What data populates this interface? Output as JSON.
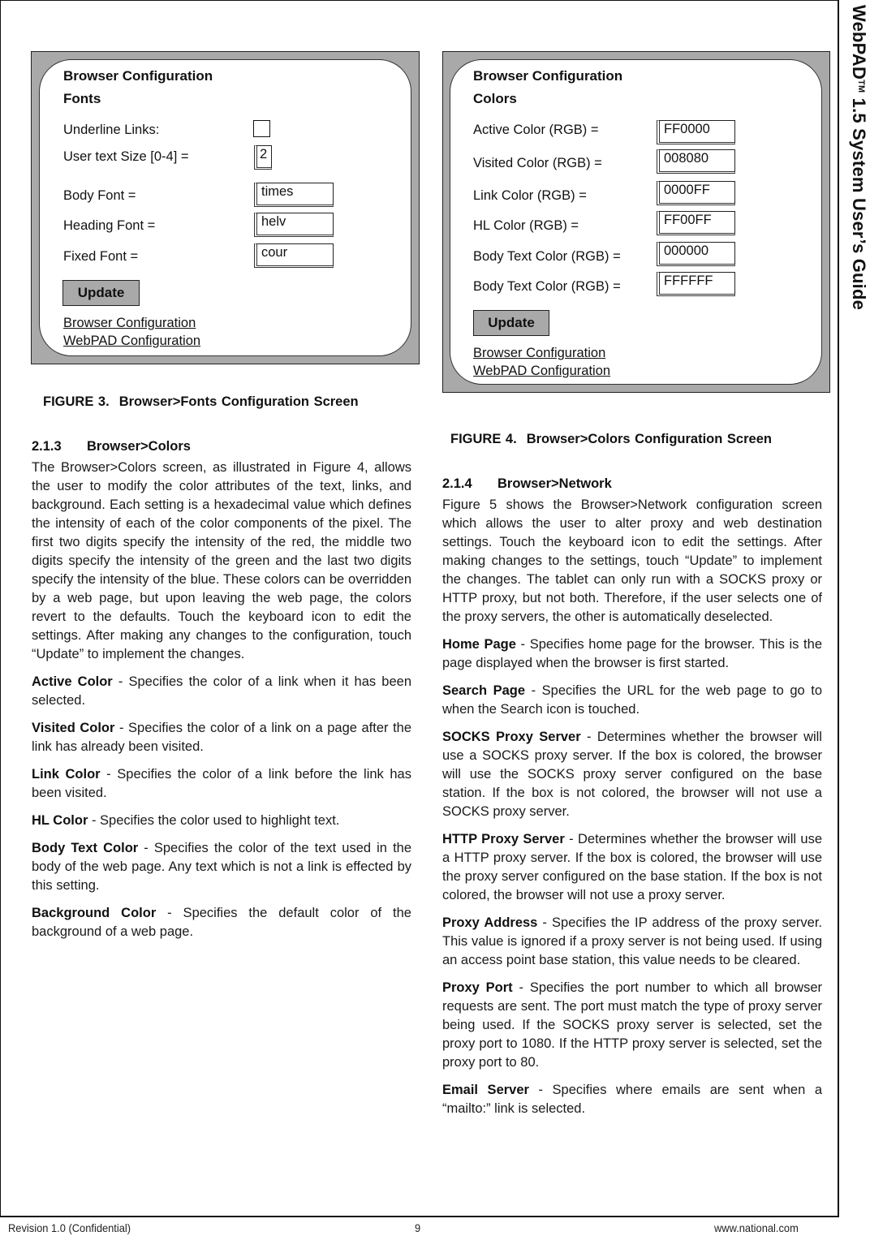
{
  "side_title": {
    "product": "WebPAD",
    "trademark": "TM",
    "rest": " 1.5 System User’s Guide"
  },
  "figure3": {
    "screen": {
      "title": "Browser Configuration",
      "subtitle": "Fonts",
      "fields": [
        {
          "label": "Underline Links:",
          "type": "checkbox",
          "checked": false
        },
        {
          "label": "User text Size [0-4] =",
          "type": "text",
          "value": "2"
        },
        {
          "label": "Body Font =",
          "type": "text",
          "value": "times"
        },
        {
          "label": "Heading Font =",
          "type": "text",
          "value": "helv"
        },
        {
          "label": "Fixed Font =",
          "type": "text",
          "value": "cour"
        }
      ],
      "update_label": "Update",
      "links": [
        "Browser Configuration",
        "WebPAD Configuration"
      ]
    },
    "caption_number": "FIGURE 3.",
    "caption_text": "Browser>Fonts Configuration Screen"
  },
  "figure4": {
    "screen": {
      "title": "Browser Configuration",
      "subtitle": "Colors",
      "fields": [
        {
          "label": "Active Color (RGB) =",
          "value": "FF0000"
        },
        {
          "label": "Visited Color (RGB) =",
          "value": "008080"
        },
        {
          "label": "Link Color (RGB) =",
          "value": "0000FF"
        },
        {
          "label": "HL Color (RGB) =",
          "value": "FF00FF"
        },
        {
          "label": "Body Text Color (RGB) =",
          "value": "000000"
        },
        {
          "label": "Body Text Color (RGB) =",
          "value": "FFFFFF"
        }
      ],
      "update_label": "Update",
      "links": [
        "Browser Configuration",
        "WebPAD Configuration"
      ]
    },
    "caption_number": "FIGURE 4.",
    "caption_text": "Browser>Colors Configuration Screen"
  },
  "section_213": {
    "number": "2.1.3",
    "title": "Browser>Colors",
    "intro": "The Browser>Colors screen, as illustrated in Figure 4, allows the user to modify the color attributes of the text, links, and background. Each setting is a hexadecimal value which defines the intensity of each of the color components of the pixel. The first two digits specify the intensity of the red, the middle two digits specify the intensity of the green and the last two digits specify the intensity of the blue. These colors can be overridden by a web page, but upon leaving the web page, the colors revert to the defaults. Touch the keyboard icon to edit the settings. After making any changes to the configuration, touch “Update” to implement the changes.",
    "definitions": [
      {
        "term": "Active Color",
        "text": " - Specifies the color of a link when it has been selected."
      },
      {
        "term": "Visited Color",
        "text": " - Specifies the color of a link on a page after the link has already been visited."
      },
      {
        "term": "Link Color",
        "text": " - Specifies the color of a link before the link has been visited."
      },
      {
        "term": "HL Color",
        "text": " - Specifies the color used to highlight text."
      },
      {
        "term": "Body Text Color",
        "text": " - Specifies the color of the text used in the body of the web page. Any text which is not a link is effected by this setting."
      },
      {
        "term": "Background Color",
        "text": " - Specifies the default color of the background of a web page."
      }
    ]
  },
  "section_214": {
    "number": "2.1.4",
    "title": "Browser>Network",
    "intro": "Figure 5 shows the Browser>Network configuration screen which allows the user to alter proxy and web destination settings. Touch the keyboard icon to edit the settings. After making changes to the settings, touch “Update” to implement the changes. The tablet can only run with a SOCKS proxy or HTTP proxy, but not both. Therefore, if the user selects one of the proxy servers, the other is automatically deselected.",
    "definitions": [
      {
        "term": "Home Page",
        "text": " - Specifies home page for the browser. This is the page displayed when the browser is first started."
      },
      {
        "term": "Search Page",
        "text": " - Specifies the URL for the web page to go to when the Search icon is touched."
      },
      {
        "term": "SOCKS Proxy Server",
        "text": " - Determines whether the browser will use a SOCKS proxy server. If the box is colored, the browser will use the SOCKS proxy server configured on the base station. If the box is not colored, the browser will not use a SOCKS proxy server."
      },
      {
        "term": "HTTP Proxy Server",
        "text": " - Determines whether the browser will use a HTTP proxy server. If the box is colored, the browser will use the proxy server configured on the base station. If the box is not colored, the browser will not use a proxy server."
      },
      {
        "term": "Proxy Address",
        "text": " - Specifies the IP address of the proxy server. This value is ignored if a proxy server is not being used. If using an access point base station, this value needs to be cleared."
      },
      {
        "term": "Proxy Port",
        "text": " - Specifies the port number to which all browser requests are sent. The port must match the type of proxy server being used. If the SOCKS proxy server is selected, set the proxy port to 1080. If the HTTP proxy server is selected, set the proxy port to 80."
      },
      {
        "term": "Email Server",
        "text": " - Specifies where emails are sent when a “mailto:” link is selected."
      }
    ]
  },
  "footer": {
    "left": "Revision 1.0 (Confidential)",
    "page_number": "9",
    "right": "www.national.com"
  }
}
